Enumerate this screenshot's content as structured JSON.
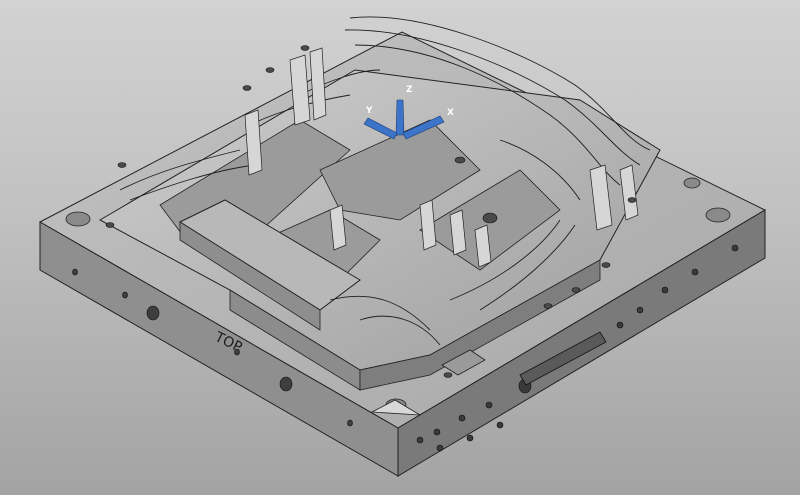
{
  "viewport": {
    "engraving_text": "TOP",
    "triad": {
      "x_label": "X",
      "y_label": "Y",
      "z_label": "Z",
      "color": "#3b74c9"
    },
    "colors": {
      "background_top": "#d2d2d2",
      "background_bottom": "#a3a3a3",
      "part_top": "#b4b4b4",
      "part_side_left": "#8f8f8f",
      "part_side_right": "#7b7b7b",
      "edge": "#202020"
    }
  }
}
